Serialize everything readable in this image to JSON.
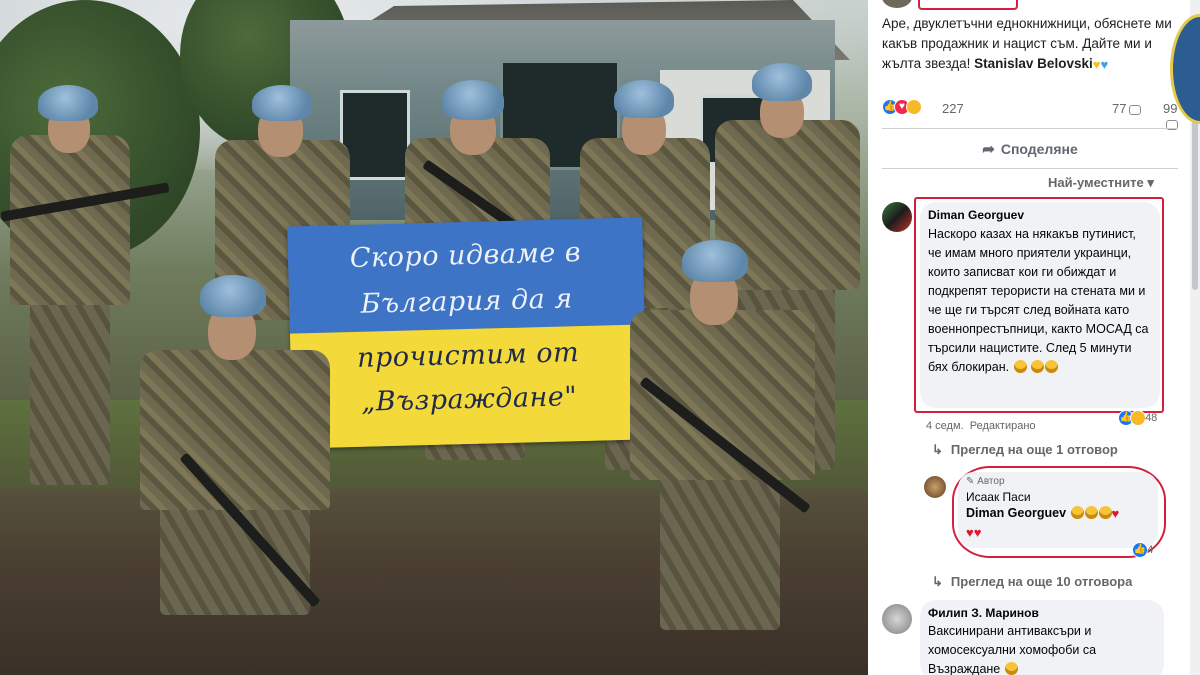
{
  "post": {
    "text_line": "Аре, двуклетъчни еднокнижници, обяснете ми какъв продажник и нацист съм. Дайте ми и жълта звезда!",
    "tagged_name": "Stanislav Belovski",
    "reaction_count": "227",
    "comment_count": "77",
    "share_count": "99",
    "share_label": "Споделяне",
    "sort_label": "Най-уместните"
  },
  "flag": {
    "line1": "Скоро идваме в",
    "line2": "България да я",
    "line3": "прочистим от",
    "line4": "„Възраждане\""
  },
  "comments": [
    {
      "author": "Diman Georguev",
      "text": "Наскоро казах на някакъв путинист, че имам много приятели украинци, които записват кои ги обиждат и подкрепят терористи на стената ми и че ще ги търсят след войната като военнопрестъпници, както МОСАД са търсили нацистите. След 5 минути бях блокиран.",
      "time": "4 седм.",
      "edited": "Редактирано",
      "reactions": "48",
      "more_replies": "Преглед на още 1 отговор"
    },
    {
      "author_tag": "Автор",
      "author": "Исаак Паси",
      "mention": "Diman Georguev",
      "reactions": "4",
      "more_replies": "Преглед на още 10 отговора"
    },
    {
      "author": "Филип З. Маринов",
      "text": "Ваксинирани антиваксъри и хомосексуални хомофоби са Възраждане"
    }
  ],
  "colors": {
    "highlight_red": "#d0213f",
    "fb_blue": "#1877f2",
    "flag_blue": "#3d74c6",
    "flag_yellow": "#f4d93b"
  }
}
